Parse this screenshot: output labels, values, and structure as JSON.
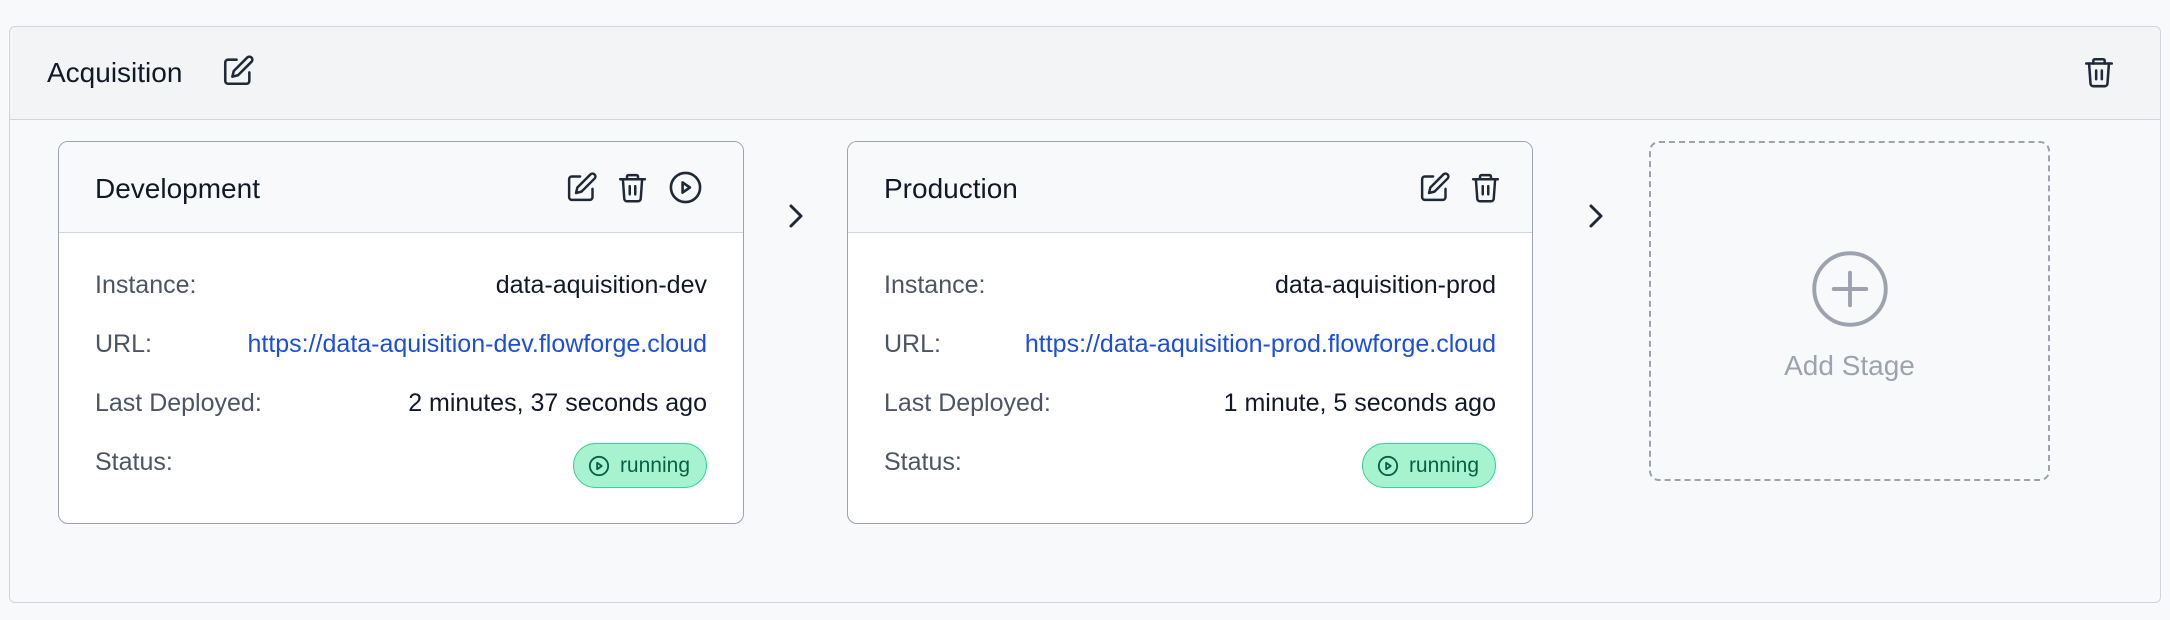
{
  "pipeline": {
    "name": "Acquisition"
  },
  "stages": [
    {
      "title": "Development",
      "instance_label": "Instance:",
      "instance": "data-aquisition-dev",
      "url_label": "URL:",
      "url": "https://data-aquisition-dev.flowforge.cloud",
      "deployed_label": "Last Deployed:",
      "last_deployed": "2 minutes, 37 seconds ago",
      "status_label": "Status:",
      "status": "running"
    },
    {
      "title": "Production",
      "instance_label": "Instance:",
      "instance": "data-aquisition-prod",
      "url_label": "URL:",
      "url": "https://data-aquisition-prod.flowforge.cloud",
      "deployed_label": "Last Deployed:",
      "last_deployed": "1 minute, 5 seconds ago",
      "status_label": "Status:",
      "status": "running"
    }
  ],
  "add_stage": {
    "label": "Add Stage"
  },
  "icons": {
    "edit": "pencil-square-icon",
    "delete": "trash-icon",
    "deploy": "play-circle-icon",
    "next": "chevron-right-icon",
    "add": "plus-circle-icon"
  },
  "colors": {
    "status_running_bg": "#a7f3d0",
    "status_running_border": "#34d399",
    "status_running_text": "#065f46",
    "link": "#1d4ed8"
  }
}
